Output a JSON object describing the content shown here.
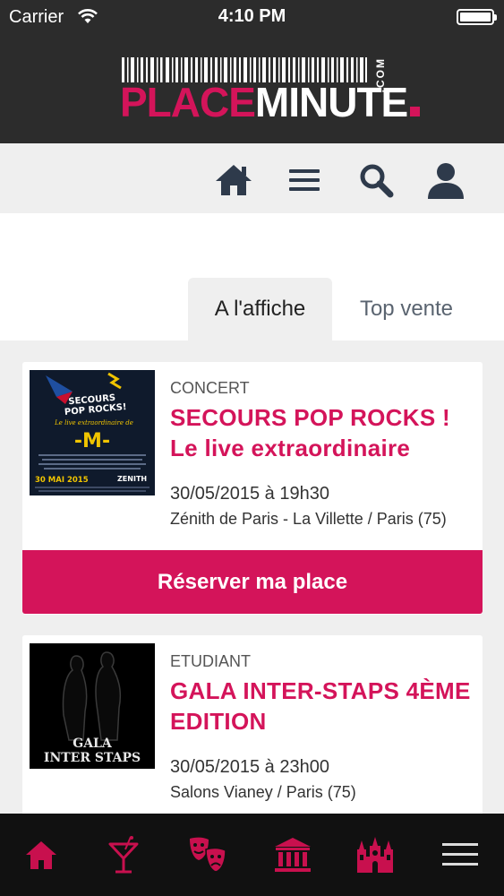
{
  "status": {
    "carrier": "Carrier",
    "time": "4:10 PM"
  },
  "logo": {
    "place": "PLACE",
    "minute": "MINUTE",
    "com": ".COM"
  },
  "toolbar": {
    "icons": [
      "home-icon",
      "menu-icon",
      "search-icon",
      "user-icon"
    ]
  },
  "tabs": [
    {
      "label": "A l'affiche",
      "active": true
    },
    {
      "label": "Top vente",
      "active": false
    }
  ],
  "events": [
    {
      "category": "CONCERT",
      "title": "SECOURS POP ROCKS ! Le live extraordinaire",
      "date": "30/05/2015 à 19h30",
      "venue": "Zénith de Paris - La Villette / Paris (75)",
      "button": "Réserver ma place",
      "poster": {
        "line1": "SECOURS",
        "line2": "POP ROCKS!",
        "script": "Le live extraordinaire de",
        "initial": "-M-",
        "date": "30 MAI 2015",
        "venue": "ZENITH"
      }
    },
    {
      "category": "ETUDIANT",
      "title": "GALA INTER-STAPS 4ÈME EDITION",
      "date": "30/05/2015 à 23h00",
      "venue": "Salons Vianey / Paris (75)",
      "poster": {
        "line1": "GALA",
        "line2": "INTER STAPS"
      }
    }
  ],
  "bottom_nav": [
    "home-icon",
    "cocktail-icon",
    "theater-masks-icon",
    "museum-icon",
    "cathedral-icon",
    "hamburger-menu-icon"
  ],
  "colors": {
    "accent": "#d4145a",
    "header_bg": "#2c2c2c",
    "nav_bg": "#111111",
    "nav_icon": "#c8104e"
  }
}
